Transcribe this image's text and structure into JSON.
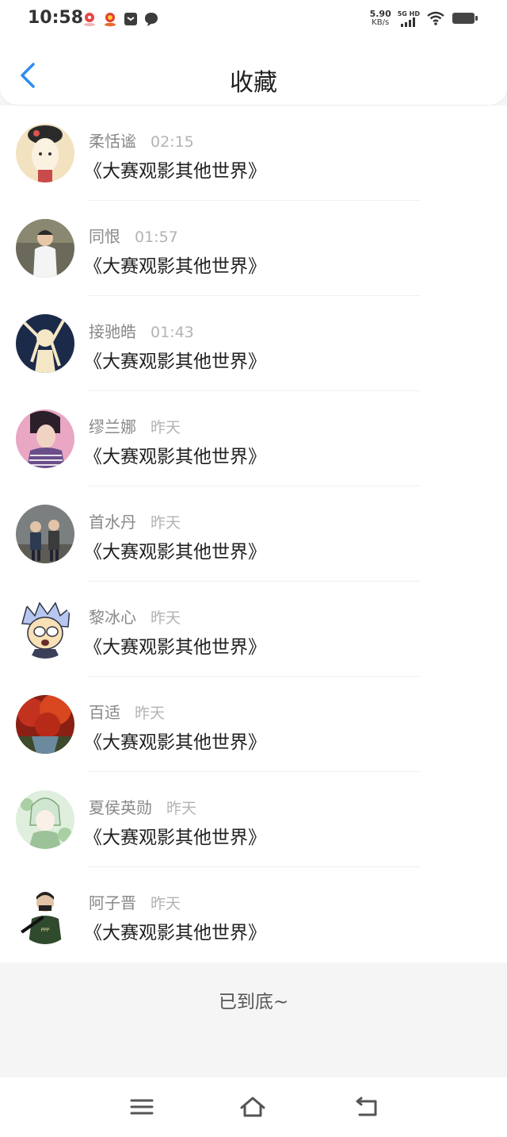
{
  "status_bar": {
    "time": "10:58",
    "net_speed_value": "5.90",
    "net_speed_unit": "KB/s",
    "network": "5G HD",
    "icons": [
      "map-pin-icon",
      "app-badge-icon",
      "gallery-icon",
      "chat-bubble-icon",
      "signal-icon",
      "wifi-icon",
      "battery-icon"
    ]
  },
  "header": {
    "title": "收藏",
    "back_icon": "chevron-left-icon",
    "accent_color": "#2d8cf0"
  },
  "favorites": [
    {
      "name": "柔恬谧",
      "time": "02:15",
      "work": "《大赛观影其他世界》"
    },
    {
      "name": "同恨",
      "time": "01:57",
      "work": "《大赛观影其他世界》"
    },
    {
      "name": "接驰皓",
      "time": "01:43",
      "work": "《大赛观影其他世界》"
    },
    {
      "name": "缪兰娜",
      "time": "昨天",
      "work": "《大赛观影其他世界》"
    },
    {
      "name": "首水丹",
      "time": "昨天",
      "work": "《大赛观影其他世界》"
    },
    {
      "name": "黎冰心",
      "time": "昨天",
      "work": "《大赛观影其他世界》"
    },
    {
      "name": "百适",
      "time": "昨天",
      "work": "《大赛观影其他世界》"
    },
    {
      "name": "夏侯英勋",
      "time": "昨天",
      "work": "《大赛观影其他世界》"
    },
    {
      "name": "阿子晋",
      "time": "昨天",
      "work": "《大赛观影其他世界》"
    }
  ],
  "footer": {
    "end_text": "已到底~"
  },
  "nav_bar": {
    "icons": [
      "menu-icon",
      "home-icon",
      "back-icon"
    ]
  }
}
